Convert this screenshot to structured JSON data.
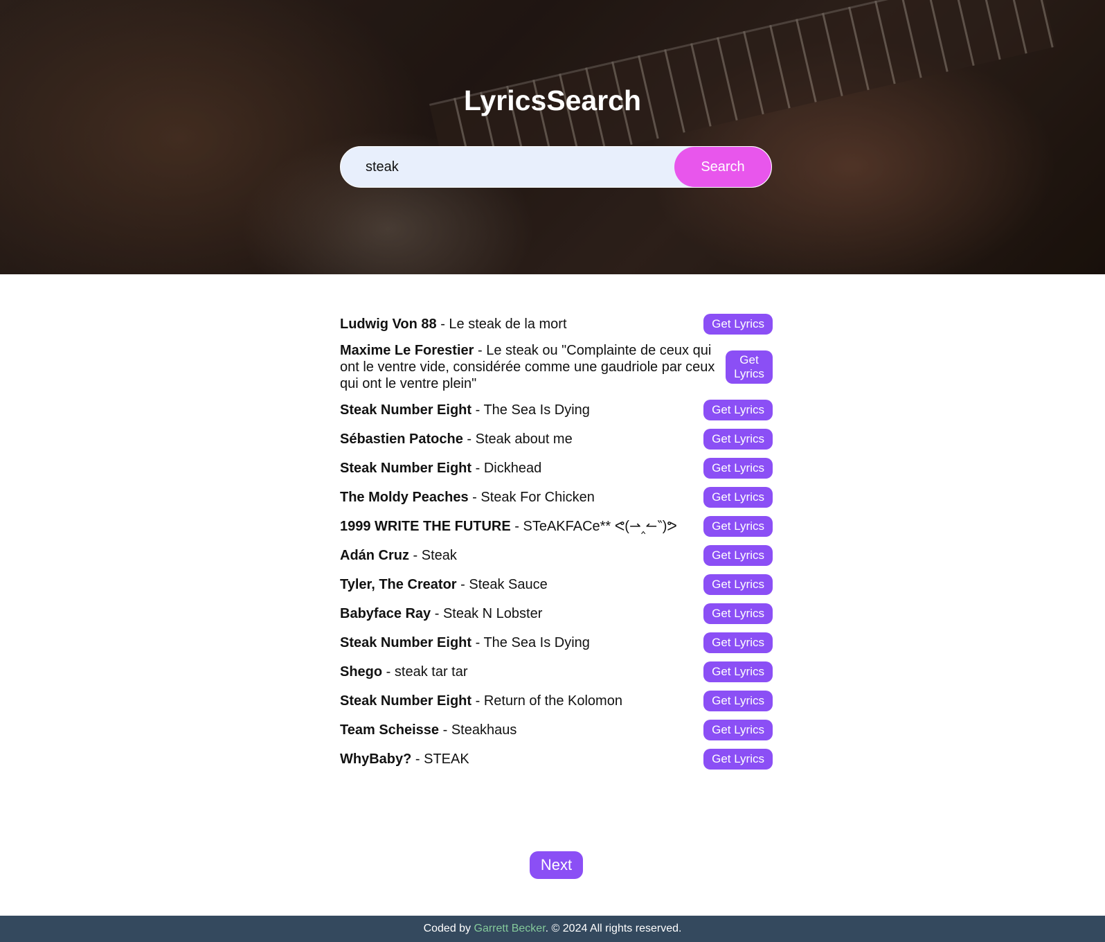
{
  "header": {
    "title": "LyricsSearch"
  },
  "search": {
    "value": "steak",
    "button_label": "Search"
  },
  "results": [
    {
      "artist": "Ludwig Von 88",
      "title": "Le steak de la mort",
      "button": "Get Lyrics"
    },
    {
      "artist": "Maxime Le Forestier",
      "title": "Le steak ou \"Complainte de ceux qui ont le ventre vide, considérée comme une gaudriole par ceux qui ont le ventre plein\"",
      "button": "Get Lyrics"
    },
    {
      "artist": "Steak Number Eight",
      "title": "The Sea Is Dying",
      "button": "Get Lyrics"
    },
    {
      "artist": "Sébastien Patoche",
      "title": "Steak about me",
      "button": "Get Lyrics"
    },
    {
      "artist": "Steak Number Eight",
      "title": "Dickhead",
      "button": "Get Lyrics"
    },
    {
      "artist": "The Moldy Peaches",
      "title": "Steak For Chicken",
      "button": "Get Lyrics"
    },
    {
      "artist": "1999 WRITE THE FUTURE",
      "title": "STeAKFACe** ᕙ(⇀‸↼‶)ᕗ",
      "button": "Get Lyrics"
    },
    {
      "artist": "Adán Cruz",
      "title": "Steak",
      "button": "Get Lyrics"
    },
    {
      "artist": "Tyler, The Creator",
      "title": "Steak Sauce",
      "button": "Get Lyrics"
    },
    {
      "artist": "Babyface Ray",
      "title": "Steak N Lobster",
      "button": "Get Lyrics"
    },
    {
      "artist": "Steak Number Eight",
      "title": "The Sea Is Dying",
      "button": "Get Lyrics"
    },
    {
      "artist": "Shego",
      "title": "steak tar tar",
      "button": "Get Lyrics"
    },
    {
      "artist": "Steak Number Eight",
      "title": "Return of the Kolomon",
      "button": "Get Lyrics"
    },
    {
      "artist": "Team Scheisse",
      "title": "Steakhaus",
      "button": "Get Lyrics"
    },
    {
      "artist": "WhyBaby?",
      "title": "STEAK",
      "button": "Get Lyrics"
    }
  ],
  "separator": " - ",
  "pagination": {
    "next_label": "Next"
  },
  "footer": {
    "prefix": "Coded by ",
    "author": "Garrett Becker",
    "suffix": ". © 2024 All rights reserved."
  },
  "colors": {
    "search_button": "#e856ec",
    "lyrics_button": "#8b4ff5",
    "footer_bg": "#34495e",
    "footer_link": "#84c99b"
  }
}
